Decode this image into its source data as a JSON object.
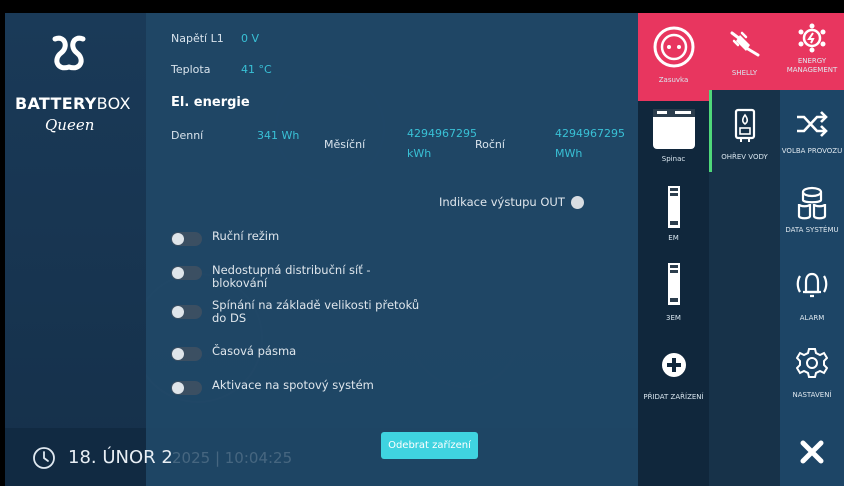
{
  "brand": {
    "name_bold": "BATTERY",
    "name_light": "BOX",
    "subtitle": "Queen"
  },
  "datebar": {
    "date": "18. ÚNOR 2",
    "time_faint": "2025 | 10:04:25"
  },
  "panel": {
    "voltage_label": "Napětí L1",
    "voltage_value": "0 V",
    "temp_label": "Teplota",
    "temp_value": "41 °C",
    "section_title": "El. energie",
    "daily_label": "Denní",
    "daily_value": "341 Wh",
    "monthly_label": "Měsíční",
    "monthly_value": "4294967295",
    "monthly_unit": "kWh",
    "yearly_label": "Roční",
    "yearly_value": "4294967295",
    "yearly_unit": "MWh",
    "out_indicator_label": "Indikace výstupu OUT",
    "toggles": [
      {
        "label": "Ruční režim",
        "on": false
      },
      {
        "label": "Nedostupná distribuční síť - blokování",
        "on": false
      },
      {
        "label": "Spínání na základě velikosti přetoků do DS",
        "on": false
      },
      {
        "label": "Časová pásma",
        "on": false
      },
      {
        "label": "Aktivace na spotový systém",
        "on": false
      }
    ],
    "remove_button": "Odebrat zařízení"
  },
  "devices": {
    "col1": [
      {
        "label": "Zasuvka",
        "icon": "socket-icon",
        "active": true
      },
      {
        "label": "Spinac",
        "icon": "switch-module-icon"
      },
      {
        "label": "EM",
        "icon": "din-meter-icon"
      },
      {
        "label": "3EM",
        "icon": "din-meter-icon"
      },
      {
        "label": "PŘIDAT ZAŘÍZENÍ",
        "icon": "plus-circle-icon"
      }
    ],
    "col2": [
      {
        "label": "SHELLY",
        "icon": "plug-icon",
        "active": true
      },
      {
        "label": "OHŘEV VODY",
        "icon": "water-heater-icon"
      }
    ]
  },
  "menu": [
    {
      "label": "ENERGY MANAGEMENT",
      "icon": "energy-management-icon",
      "active": true
    },
    {
      "label": "VOLBA PROVOZU",
      "icon": "shuffle-icon"
    },
    {
      "label": "DATA SYSTÉMU",
      "icon": "database-icon"
    },
    {
      "label": "ALARM",
      "icon": "alarm-bell-icon"
    },
    {
      "label": "NASTAVENÍ",
      "icon": "gear-icon"
    },
    {
      "label": "",
      "icon": "close-icon"
    }
  ],
  "colors": {
    "accent_pink": "#e8365f",
    "value_cyan": "#39c1d6",
    "button_cyan": "#3fd3e0",
    "active_green": "#4fd87a"
  }
}
